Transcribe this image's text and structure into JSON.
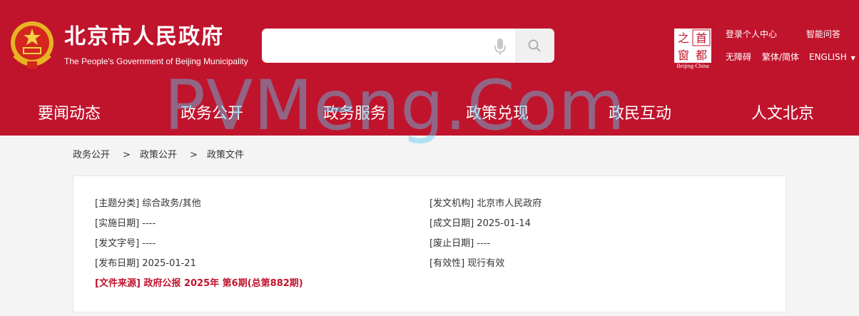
{
  "header": {
    "title": "北京市人民政府",
    "subtitle": "The People's Government of Beijing Municipality",
    "search_placeholder": "",
    "capital_logo": {
      "chars": [
        "首",
        "都",
        "之",
        "窗"
      ],
      "caption": "Beijing-China"
    },
    "links": {
      "login": "登录个人中心",
      "smart_qa": "智能问答",
      "accessibility": "无障碍",
      "traditional_simplified": "繁体/简体",
      "english": "ENGLISH"
    },
    "colors": {
      "brand_red": "#c0142d"
    }
  },
  "nav": {
    "items": [
      "要闻动态",
      "政务公开",
      "政务服务",
      "政策兑现",
      "政民互动",
      "人文北京"
    ]
  },
  "breadcrumb": {
    "items": [
      "政务公开",
      "政策公开",
      "政策文件"
    ],
    "separator": ">"
  },
  "doc_info": {
    "left": [
      {
        "label": "[主题分类]",
        "value": "综合政务/其他"
      },
      {
        "label": "[实施日期]",
        "value": "----"
      },
      {
        "label": "[发文字号]",
        "value": "----"
      },
      {
        "label": "[发布日期]",
        "value": "2025-01-21"
      }
    ],
    "right": [
      {
        "label": "[发文机构]",
        "value": "北京市人民政府"
      },
      {
        "label": "[成文日期]",
        "value": "2025-01-14"
      },
      {
        "label": "[废止日期]",
        "value": "----"
      },
      {
        "label": "[有效性]",
        "value": "现行有效"
      }
    ],
    "source": {
      "label": "[文件来源]",
      "value": "政府公报 2025年 第6期(总第882期)"
    }
  },
  "watermark": "PVMeng.Com"
}
